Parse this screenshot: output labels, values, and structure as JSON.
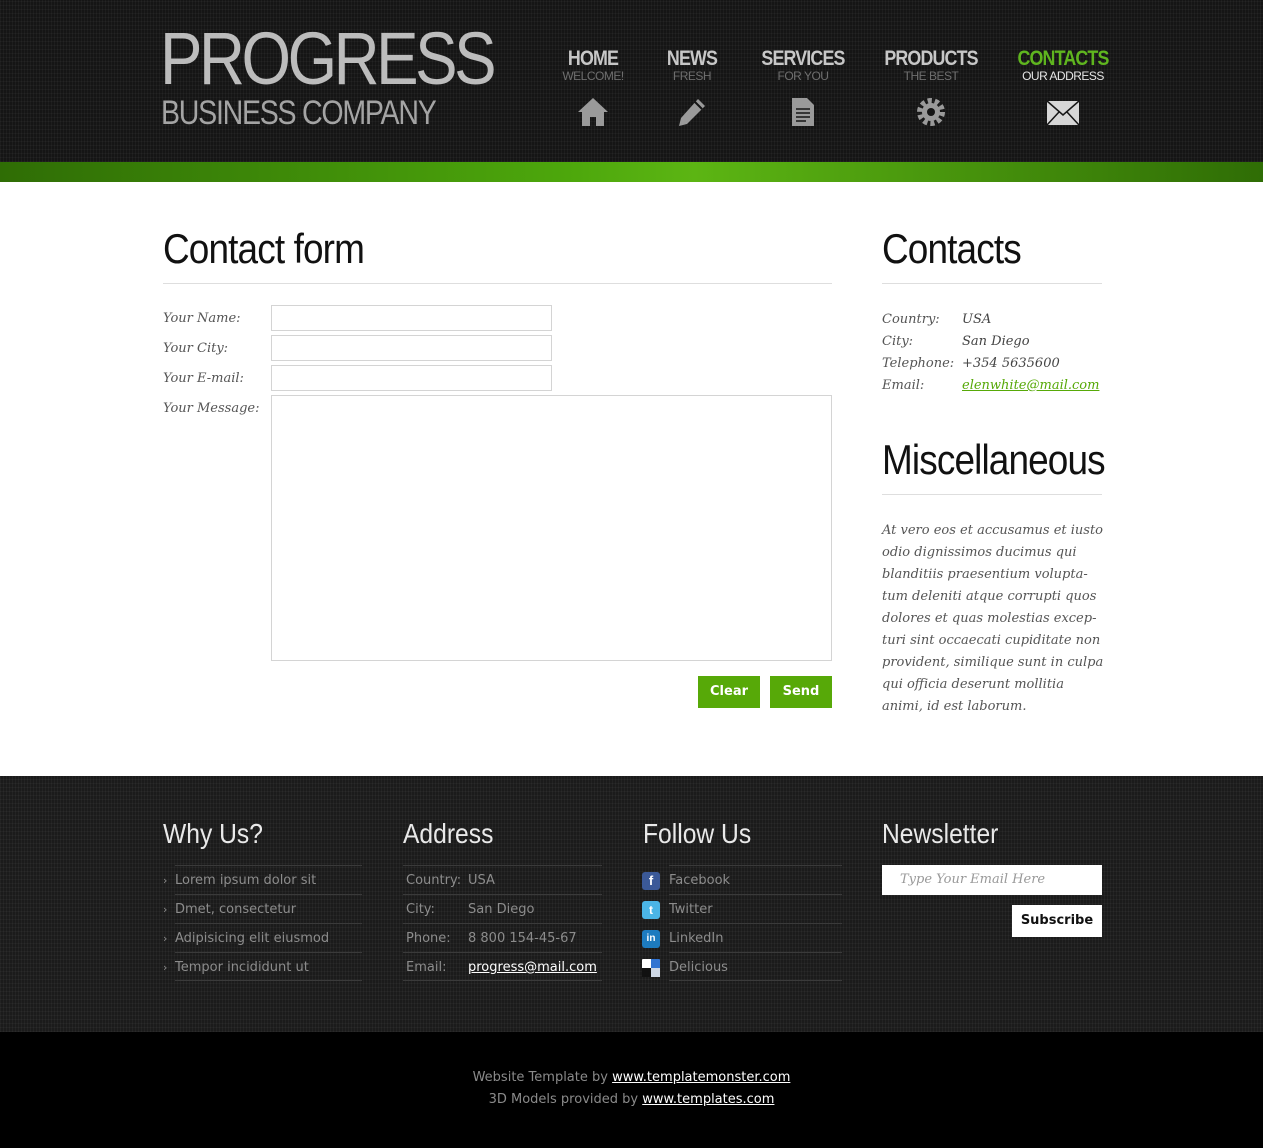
{
  "brand": {
    "name": "PROGRESS",
    "tagline": "BUSINESS COMPANY"
  },
  "nav": [
    {
      "title": "HOME",
      "sub": "WELCOME!",
      "icon": "home-icon"
    },
    {
      "title": "NEWS",
      "sub": "FRESH",
      "icon": "pencil-icon"
    },
    {
      "title": "SERVICES",
      "sub": "FOR YOU",
      "icon": "document-icon"
    },
    {
      "title": "PRODUCTS",
      "sub": "THE BEST",
      "icon": "gear-icon"
    },
    {
      "title": "CONTACTS",
      "sub": "OUR ADDRESS",
      "icon": "envelope-icon",
      "active": true
    }
  ],
  "colors": {
    "accent": "#57a908",
    "active_nav": "#5fb51f",
    "header_bg": "#151515"
  },
  "contact_form": {
    "heading": "Contact form",
    "name_label": "Your Name:",
    "city_label": "Your City:",
    "email_label": "Your E-mail:",
    "message_label": "Your Message:",
    "name_value": "",
    "city_value": "",
    "email_value": "",
    "message_value": "",
    "clear_label": "Clear",
    "send_label": "Send"
  },
  "contacts": {
    "heading": "Contacts",
    "rows": [
      {
        "key": "Country:",
        "value": "USA"
      },
      {
        "key": "City:",
        "value": "San Diego"
      },
      {
        "key": "Telephone:",
        "value": "+354 5635600"
      },
      {
        "key": "Email:",
        "value": "elenwhite@mail.com"
      }
    ]
  },
  "misc": {
    "heading": "Miscellaneous",
    "text": "At vero eos et accusamus et iusto odio dignissimos ducimus qui blanditiis praesentium volupta-tum deleniti atque corrupti quos dolores et quas molestias excep-turi sint occaecati cupiditate non provident, similique sunt in culpa qui officia deserunt mollitia animi, id est laborum."
  },
  "footer": {
    "why": {
      "heading": "Why Us?",
      "items": [
        "Lorem ipsum dolor sit",
        "Dmet, consectetur",
        "Adipisicing elit eiusmod",
        "Tempor incididunt ut"
      ]
    },
    "address": {
      "heading": "Address",
      "rows": [
        {
          "key": "Country:",
          "value": "USA"
        },
        {
          "key": "City:",
          "value": "San Diego"
        },
        {
          "key": "Phone:",
          "value": "8 800 154-45-67"
        },
        {
          "key": "Email:",
          "value": "progress@mail.com"
        }
      ]
    },
    "follow": {
      "heading": "Follow Us",
      "items": [
        {
          "label": "Facebook",
          "icon": "facebook-icon"
        },
        {
          "label": "Twitter",
          "icon": "twitter-icon"
        },
        {
          "label": "LinkedIn",
          "icon": "linkedin-icon"
        },
        {
          "label": "Delicious",
          "icon": "delicious-icon"
        }
      ]
    },
    "newsletter": {
      "heading": "Newsletter",
      "placeholder": "Type Your Email Here",
      "button": "Subscribe"
    }
  },
  "credits": {
    "line1_text": "Website Template by",
    "line1_link": "www.templatemonster.com",
    "line2_text": "3D Models provided by",
    "line2_link": "www.templates.com"
  }
}
